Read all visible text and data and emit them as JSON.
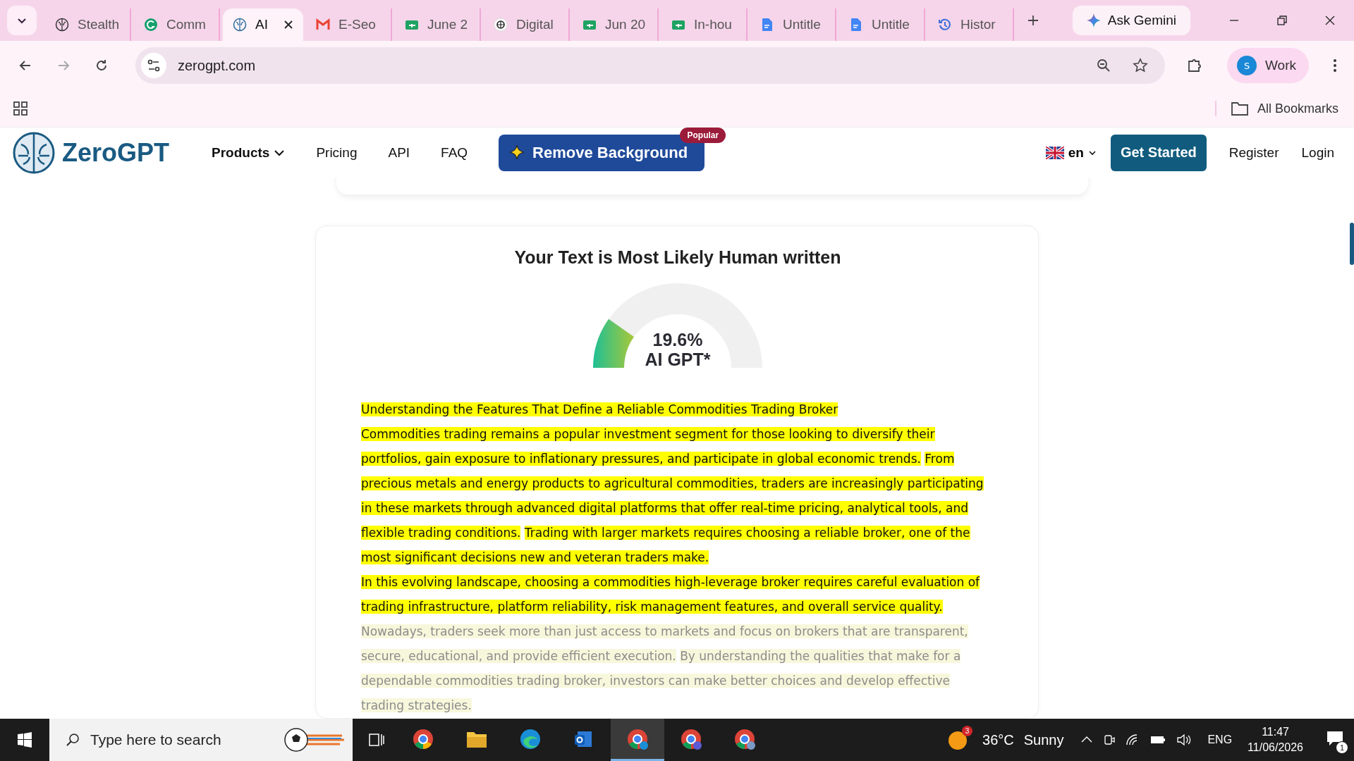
{
  "browser": {
    "tabs": [
      {
        "title": "Stealth",
        "kind": "brain",
        "selected": false
      },
      {
        "title": "Comm",
        "kind": "grammar",
        "selected": false
      },
      {
        "title": "AI",
        "kind": "zerogpt",
        "selected": true
      },
      {
        "title": "E-Seo",
        "kind": "mail",
        "selected": false
      },
      {
        "title": "June 2",
        "kind": "sheet",
        "selected": false
      },
      {
        "title": "Digital",
        "kind": "knot",
        "selected": false
      },
      {
        "title": "Jun 20",
        "kind": "sheet",
        "selected": false
      },
      {
        "title": "In-hou",
        "kind": "sheet",
        "selected": false
      },
      {
        "title": "Untitle",
        "kind": "doc",
        "selected": false
      },
      {
        "title": "Untitle",
        "kind": "doc",
        "selected": false
      },
      {
        "title": "Histor",
        "kind": "history",
        "selected": false
      }
    ],
    "gemini_button": "Ask Gemini",
    "url": "zerogpt.com",
    "profile": {
      "initial": "S",
      "name": "Work"
    },
    "bookmarks_label": "All Bookmarks"
  },
  "site_nav": {
    "logo": "ZeroGPT",
    "items": [
      {
        "label": "Products",
        "dropdown": true
      },
      {
        "label": "Pricing",
        "dropdown": false
      },
      {
        "label": "API",
        "dropdown": false
      },
      {
        "label": "FAQ",
        "dropdown": false
      }
    ],
    "promo_button": "Remove Background",
    "promo_badge": "Popular",
    "language": "en",
    "cta": "Get Started",
    "register": "Register",
    "login": "Login"
  },
  "result": {
    "title": "Your Text is Most Likely Human written",
    "gauge": {
      "level": 0.196,
      "percent": "19.6%",
      "label": "AI GPT*"
    },
    "paragraphs": [
      {
        "faded": false,
        "sentences": [
          {
            "text": "Understanding the Features That Define a Reliable Commodities Trading Broker",
            "highlighted": true
          }
        ]
      },
      {
        "faded": false,
        "sentences": [
          {
            "text": "Commodities trading remains a popular investment segment for those looking to diversify their portfolios, gain exposure to inflationary pressures, and participate in global economic trends.",
            "highlighted": true
          },
          {
            "text": "From precious metals and energy products to agricultural commodities, traders are increasingly participating in these markets through advanced digital platforms that offer real-time pricing, analytical tools, and flexible trading conditions.",
            "highlighted": true
          },
          {
            "text": "Trading with larger markets requires choosing a reliable broker, one of the most significant decisions new and veteran traders make.",
            "highlighted": true
          }
        ]
      },
      {
        "faded": false,
        "sentences": [
          {
            "text": "In this evolving landscape, choosing a commodities high-leverage broker requires careful evaluation of trading infrastructure, platform reliability, risk management features, and overall service quality.",
            "highlighted": true
          }
        ]
      },
      {
        "faded": true,
        "sentences": [
          {
            "text": "Nowadays, traders seek more than just access to markets and focus on brokers that are transparent, secure, educational, and provide efficient execution.",
            "highlighted": true
          },
          {
            "text": "By understanding the qualities that make for a dependable commodities trading broker, investors can make better choices and develop effective trading strategies.",
            "highlighted": true
          }
        ]
      }
    ]
  },
  "taskbar": {
    "search_placeholder": "Type here to search",
    "weather": {
      "temp": "36°C",
      "condition": "Sunny",
      "badge": "3"
    },
    "language": "ENG",
    "time": "11:47",
    "date": "11/06/2026",
    "notifications": "1"
  }
}
